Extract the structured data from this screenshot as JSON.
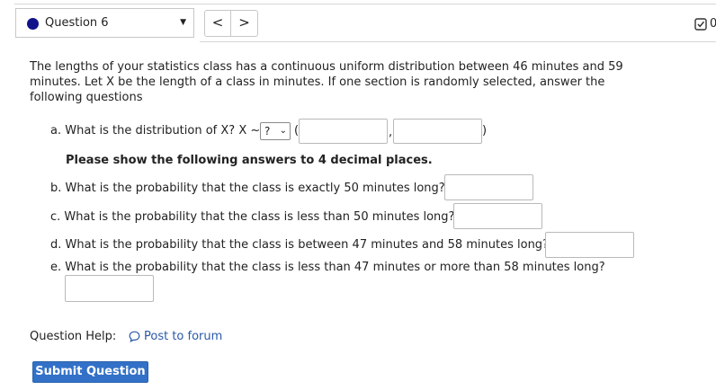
{
  "header": {
    "question_label": "Question 6",
    "prev_label": "<",
    "next_label": ">",
    "score_label": "0"
  },
  "intro": "The lengths of your statistics class has a continuous uniform distribution between 46 minutes and 59 minutes. Let X be the length of a class in minutes. If one section is randomly selected, answer the following questions",
  "parts": {
    "a": {
      "text": "a. What is the distribution of X? X ~",
      "dropdown_value": "?",
      "open_paren": "(",
      "comma": ",",
      "close_paren": ")",
      "input1_value": "",
      "input2_value": ""
    },
    "note": "Please show the following answers to 4 decimal places.",
    "b": {
      "text": "b. What is the probability that the class is exactly 50 minutes long?",
      "value": ""
    },
    "c": {
      "text": "c. What is the probability that the class is less than 50 minutes long?",
      "value": ""
    },
    "d": {
      "text": "d. What is the probability that the class is between 47 minutes and 58 minutes long?",
      "value": ""
    },
    "e": {
      "text": "e. What is the probability that the class is less than 47 minutes or more than 58 minutes long?",
      "value": ""
    }
  },
  "help": {
    "label": "Question Help:",
    "forum_link": "Post to forum"
  },
  "submit_label": "Submit Question",
  "colors": {
    "accent": "#3271c7",
    "status_dot": "#10138a",
    "link": "#2a59a8"
  },
  "icons": {
    "status": "filled-circle-icon",
    "dropdown": "caret-down-icon",
    "score": "checkbox-check-icon",
    "forum": "speech-bubble-icon"
  }
}
